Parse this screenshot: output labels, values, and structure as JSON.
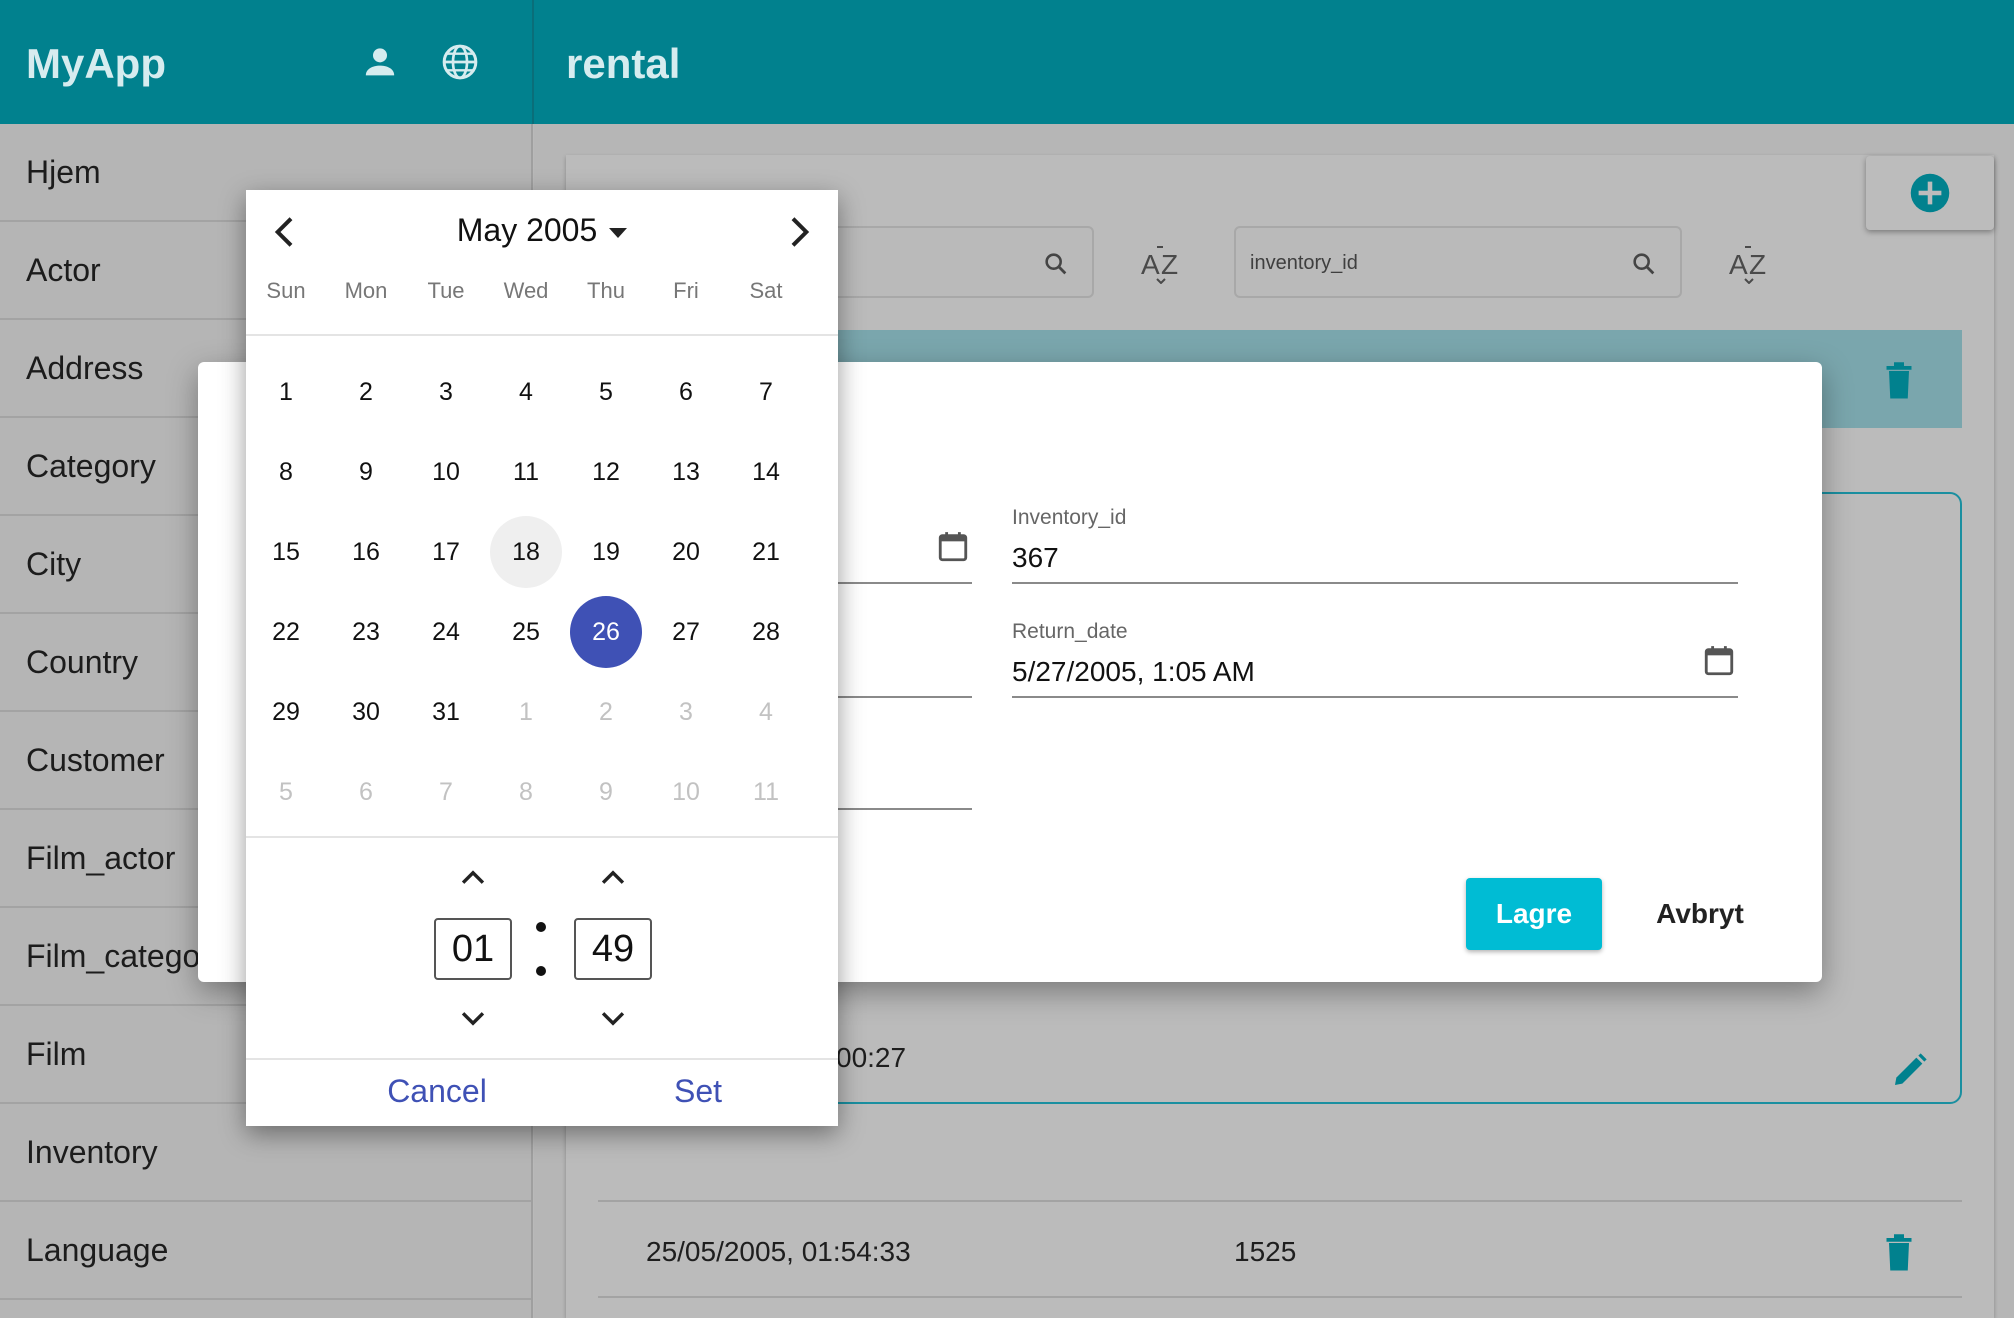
{
  "header": {
    "brand": "MyApp",
    "page_title": "rental"
  },
  "sidebar": {
    "items": [
      {
        "label": "Hjem"
      },
      {
        "label": "Actor"
      },
      {
        "label": "Address"
      },
      {
        "label": "Category"
      },
      {
        "label": "City"
      },
      {
        "label": "Country"
      },
      {
        "label": "Customer"
      },
      {
        "label": "Film_actor"
      },
      {
        "label": "Film_catego"
      },
      {
        "label": "Film"
      },
      {
        "label": "Inventory"
      },
      {
        "label": "Language"
      }
    ]
  },
  "list": {
    "search2_placeholder": "inventory_id",
    "partial_time": "00:27",
    "row": {
      "date": "25/05/2005, 01:54:33",
      "id": "1525"
    }
  },
  "dialog": {
    "inventory_label": "Inventory_id",
    "inventory_value": "367",
    "return_label": "Return_date",
    "return_value": "5/27/2005, 1:05 AM",
    "save_label": "Lagre",
    "cancel_label": "Avbryt"
  },
  "picker": {
    "month_label": "May 2005",
    "weekdays": [
      "Sun",
      "Mon",
      "Tue",
      "Wed",
      "Thu",
      "Fri",
      "Sat"
    ],
    "today_day": 18,
    "selected_day": 26,
    "weeks": [
      [
        "1",
        "2",
        "3",
        "4",
        "5",
        "6",
        "7"
      ],
      [
        "8",
        "9",
        "10",
        "11",
        "12",
        "13",
        "14"
      ],
      [
        "15",
        "16",
        "17",
        "18",
        "19",
        "20",
        "21"
      ],
      [
        "22",
        "23",
        "24",
        "25",
        "26",
        "27",
        "28"
      ],
      [
        "29",
        "30",
        "31",
        "1",
        "2",
        "3",
        "4"
      ],
      [
        "5",
        "6",
        "7",
        "8",
        "9",
        "10",
        "11"
      ]
    ],
    "hour": "01",
    "minute": "49",
    "cancel_label": "Cancel",
    "set_label": "Set"
  },
  "colors": {
    "primary": "#01818e",
    "accent": "#00bcd4",
    "picker_selected": "#3f51b5"
  },
  "icons": [
    "person-icon",
    "globe-icon",
    "add-circle-icon",
    "search-icon",
    "sort-az-icon",
    "trash-icon",
    "calendar-icon",
    "edit-icon",
    "chevron-left-icon",
    "chevron-right-icon",
    "chevron-up-icon",
    "chevron-down-icon"
  ]
}
